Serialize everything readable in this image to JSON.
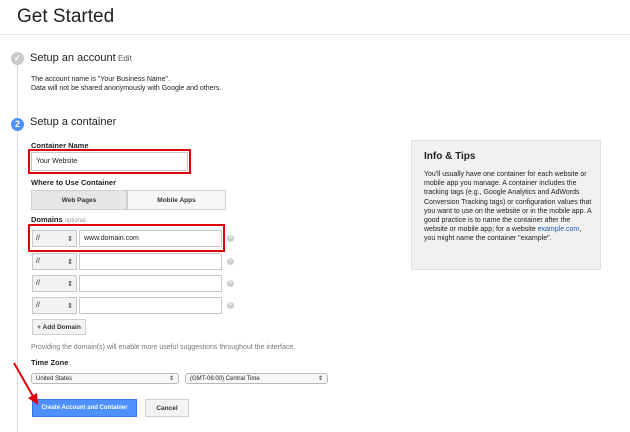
{
  "page": {
    "title": "Get Started"
  },
  "step1": {
    "number": "✓",
    "title": "Setup an account",
    "edit_label": "Edit",
    "line1": "The account name is \"Your Business Name\".",
    "line2": "Data will not be shared anonymously with Google and others."
  },
  "step2": {
    "number": "2",
    "title": "Setup a container"
  },
  "container": {
    "label": "Container Name",
    "value": "Your Website"
  },
  "where": {
    "label": "Where to Use Container",
    "tab_web": "Web Pages",
    "tab_mobile": "Mobile Apps"
  },
  "domains": {
    "label": "Domains",
    "optional": "optional",
    "rows": [
      {
        "protocol": "//",
        "value": "www.domain.com"
      },
      {
        "protocol": "//",
        "value": ""
      },
      {
        "protocol": "//",
        "value": ""
      },
      {
        "protocol": "//",
        "value": ""
      }
    ],
    "add_label": "+ Add Domain",
    "hint": "Providing the domain(s) will enable more useful suggestions throughout the interface."
  },
  "timezone": {
    "label": "Time Zone",
    "country": "United States",
    "zone": "(GMT-06:00) Central Time"
  },
  "actions": {
    "create_label": "Create Account and Container",
    "cancel_label": "Cancel"
  },
  "tips": {
    "title": "Info & Tips",
    "text_before_link": "You'll usually have one container for each website or mobile app you manage. A container includes the tracking tags (e.g., Google Analytics and AdWords Conversion Tracking tags) or configuration values that you want to use on the website or in the mobile app. A good practice is to name the container after the website or mobile app; for a website ",
    "link": "example.com",
    "text_after_link": ", you might name the container \"example\"."
  },
  "colors": {
    "accent": "#4d90fe",
    "highlight": "#e0000b",
    "annotation_arrow": "#e0000b"
  }
}
